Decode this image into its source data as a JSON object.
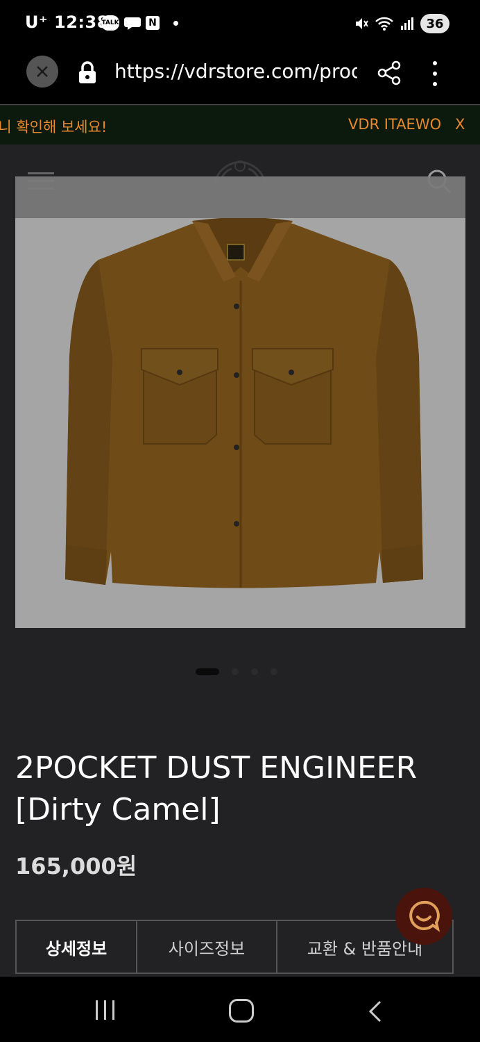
{
  "status_bar": {
    "carrier": "U⁺",
    "time": "12:38",
    "notif_talk": "TALK",
    "notif_n": "N",
    "battery": "36"
  },
  "browser": {
    "url": "https://vdrstore.com/product",
    "icons": [
      "close-icon",
      "lock-icon",
      "share-icon",
      "more-vert-icon"
    ]
  },
  "banner": {
    "left_text": "보니 확인해 보세요!",
    "right_text": "VDR ITAEWON",
    "close": "X"
  },
  "product": {
    "title_line1": "2POCKET DUST ENGINEER",
    "title_line2": "[Dirty Camel]",
    "price": "165,000원",
    "image_count": 4,
    "active_image": 1
  },
  "tabs": [
    {
      "label": "상세정보"
    },
    {
      "label": "사이즈정보"
    },
    {
      "label": "교환 & 반품안내"
    }
  ],
  "colors": {
    "banner_text": "#e8892e",
    "banner_bg": "#0b1a0d",
    "page_bg": "#222224",
    "chat_bg": "#4a130c",
    "chat_icon": "#e0a05a"
  }
}
